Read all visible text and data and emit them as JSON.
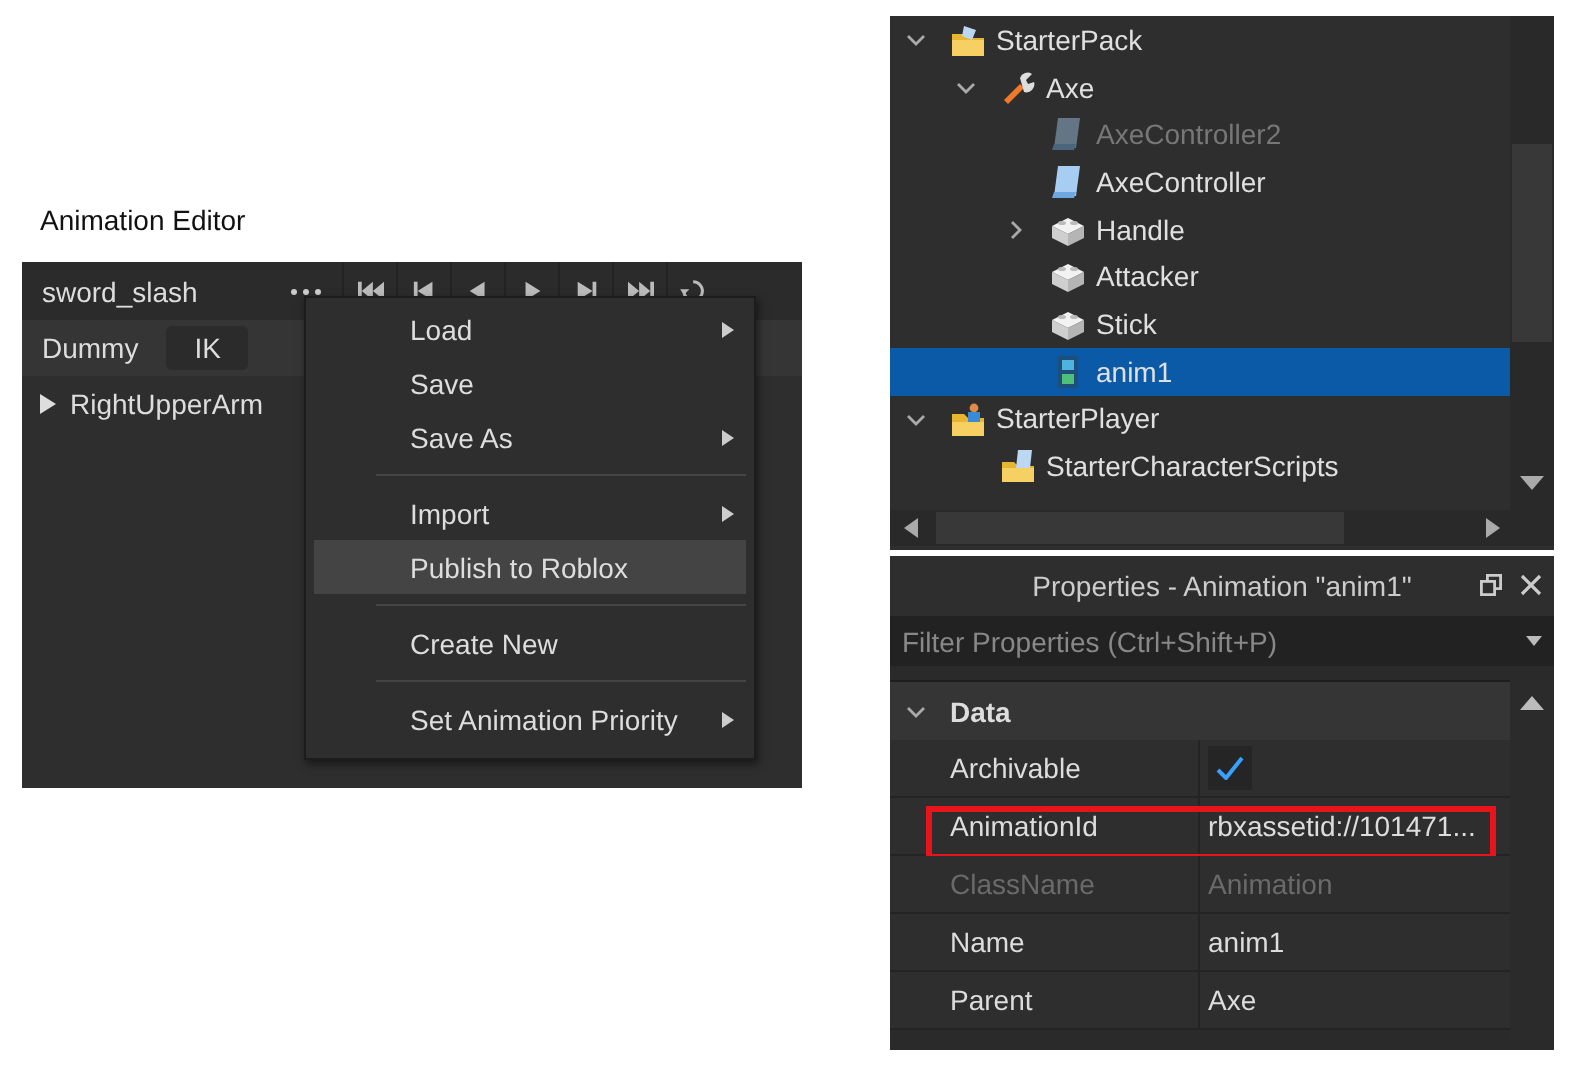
{
  "animation_editor": {
    "caption": "Animation Editor",
    "animation_name": "sword_slash",
    "rig": "Dummy",
    "ik_button": "IK",
    "tracks": [
      {
        "name": "RightUpperArm",
        "expanded": false
      }
    ]
  },
  "context_menu": {
    "items": [
      {
        "kind": "item",
        "label": "Load",
        "submenu": true,
        "selected": false
      },
      {
        "kind": "item",
        "label": "Save",
        "submenu": false,
        "selected": false
      },
      {
        "kind": "item",
        "label": "Save As",
        "submenu": true,
        "selected": false
      },
      {
        "kind": "separator"
      },
      {
        "kind": "item",
        "label": "Import",
        "submenu": true,
        "selected": false
      },
      {
        "kind": "item",
        "label": "Publish to Roblox",
        "submenu": false,
        "selected": true
      },
      {
        "kind": "separator"
      },
      {
        "kind": "item",
        "label": "Create New",
        "submenu": false,
        "selected": false
      },
      {
        "kind": "separator"
      },
      {
        "kind": "item",
        "label": "Set Animation Priority",
        "submenu": true,
        "selected": false
      }
    ]
  },
  "explorer": {
    "items": [
      {
        "name": "StarterPack",
        "kind": "folder",
        "expanded": true,
        "selected": false,
        "disabled": false,
        "children": [
          {
            "name": "Axe",
            "kind": "tool",
            "expanded": true,
            "selected": false,
            "disabled": false,
            "children": [
              {
                "name": "AxeController2",
                "kind": "script",
                "selected": false,
                "disabled": true
              },
              {
                "name": "AxeController",
                "kind": "script",
                "selected": false,
                "disabled": false
              },
              {
                "name": "Handle",
                "kind": "part",
                "expanded": false,
                "selected": false,
                "disabled": false
              },
              {
                "name": "Attacker",
                "kind": "part",
                "selected": false,
                "disabled": false
              },
              {
                "name": "Stick",
                "kind": "part",
                "selected": false,
                "disabled": false
              },
              {
                "name": "anim1",
                "kind": "animation",
                "selected": true,
                "disabled": false
              }
            ]
          }
        ]
      },
      {
        "name": "StarterPlayer",
        "kind": "player-folder",
        "expanded": true,
        "selected": false,
        "disabled": false,
        "children": [
          {
            "name": "StarterCharacterScripts",
            "kind": "script-folder",
            "selected": false,
            "disabled": false
          }
        ]
      }
    ]
  },
  "properties": {
    "title": "Properties - Animation \"anim1\"",
    "filter_placeholder": "Filter Properties (Ctrl+Shift+P)",
    "sections": [
      {
        "name": "Data",
        "expanded": true,
        "rows": [
          {
            "name": "Archivable",
            "kind": "checkbox",
            "checked": true,
            "disabled": false,
            "highlighted": false
          },
          {
            "name": "AnimationId",
            "kind": "text",
            "value": "rbxassetid://101471...",
            "disabled": false,
            "highlighted": true
          },
          {
            "name": "ClassName",
            "kind": "text",
            "value": "Animation",
            "disabled": true,
            "highlighted": false
          },
          {
            "name": "Name",
            "kind": "text",
            "value": "anim1",
            "disabled": false,
            "highlighted": false
          },
          {
            "name": "Parent",
            "kind": "text",
            "value": "Axe",
            "disabled": false,
            "highlighted": false
          }
        ]
      }
    ]
  }
}
